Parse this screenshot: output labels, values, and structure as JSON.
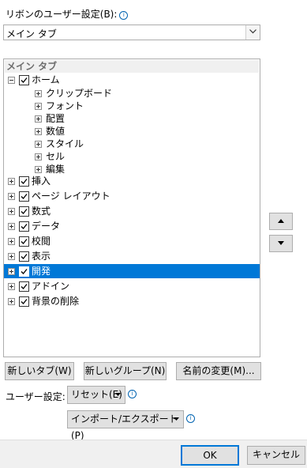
{
  "ribbon_customize_label": "リボンのユーザー設定(B):",
  "ribbon_select": {
    "value": "メイン タブ"
  },
  "tree": {
    "header": "メイン タブ",
    "home": {
      "label": "ホーム",
      "groups": [
        "クリップボード",
        "フォント",
        "配置",
        "数値",
        "スタイル",
        "セル",
        "編集"
      ]
    },
    "tabs": [
      {
        "label": "挿入",
        "checked": true,
        "selected": false
      },
      {
        "label": "ページ レイアウト",
        "checked": true,
        "selected": false
      },
      {
        "label": "数式",
        "checked": true,
        "selected": false
      },
      {
        "label": "データ",
        "checked": true,
        "selected": false
      },
      {
        "label": "校閲",
        "checked": true,
        "selected": false
      },
      {
        "label": "表示",
        "checked": true,
        "selected": false
      },
      {
        "label": "開発",
        "checked": true,
        "selected": true
      },
      {
        "label": "アドイン",
        "checked": true,
        "selected": false
      },
      {
        "label": "背景の削除",
        "checked": true,
        "selected": false
      }
    ]
  },
  "buttons": {
    "new_tab": "新しいタブ(W)",
    "new_group": "新しいグループ(N)",
    "rename": "名前の変更(M)..."
  },
  "customizations_label": "ユーザー設定:",
  "reset_button": "リセット(E)",
  "import_export_button": "インポート/エクスポート(P)",
  "ok": "OK",
  "cancel": "キャンセル",
  "colors": {
    "selection": "#0078d7",
    "info": "#0063b1"
  }
}
